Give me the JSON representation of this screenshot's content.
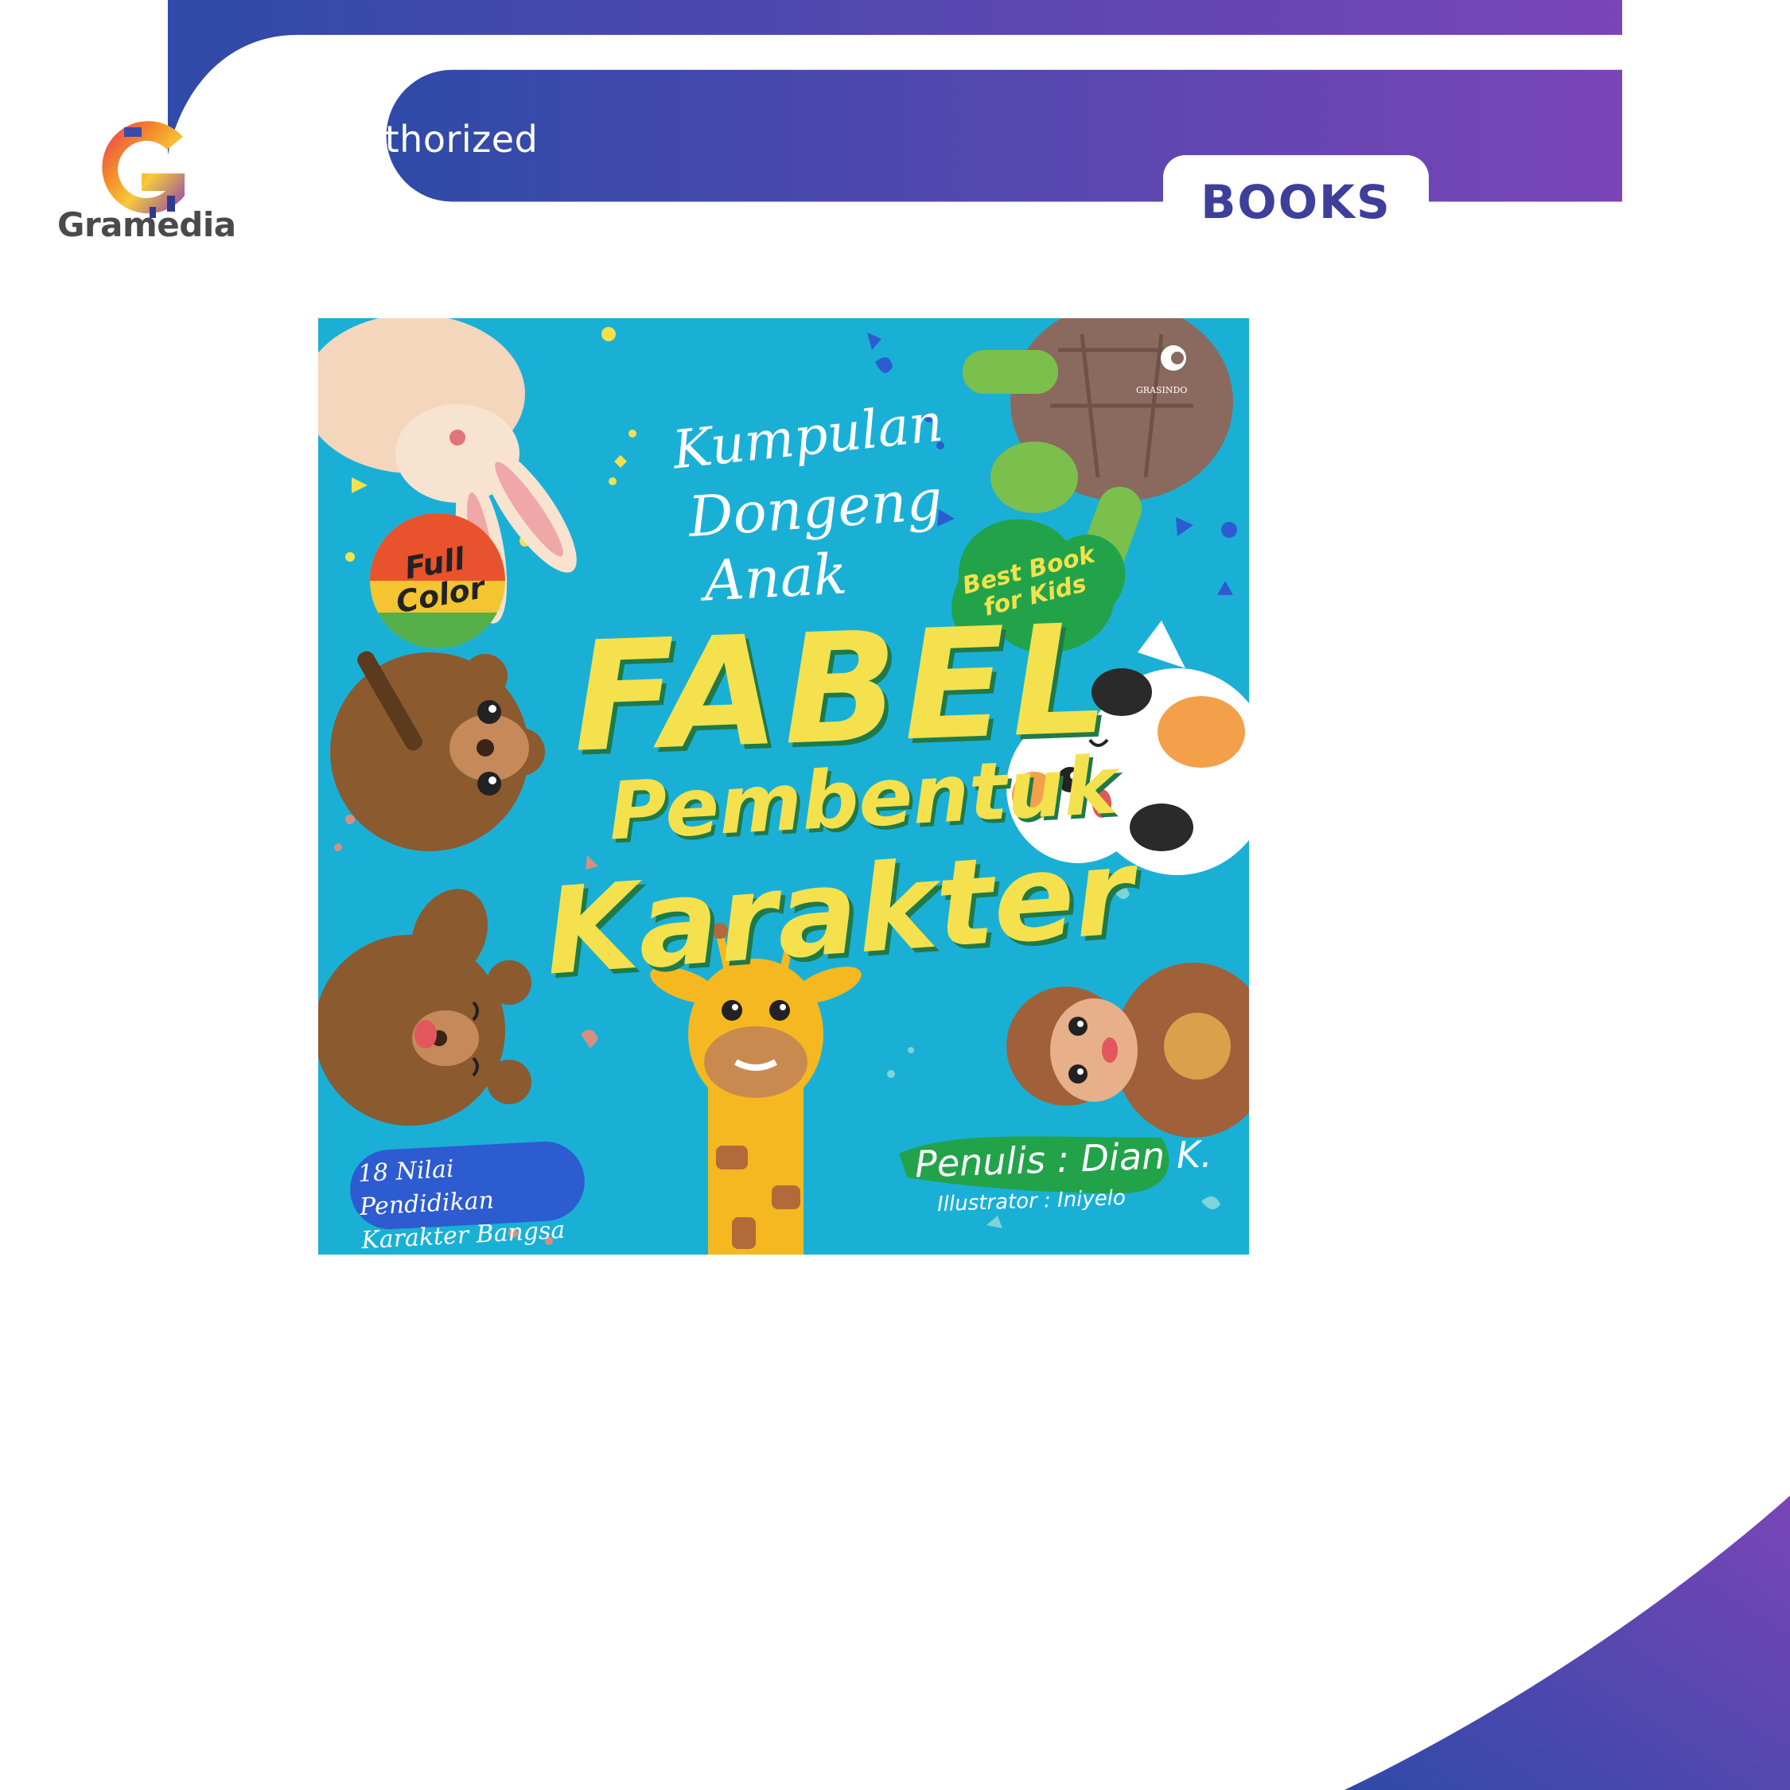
{
  "brand": {
    "name": "Gramedia",
    "colors": {
      "gradient_start": "#2f4aa8",
      "gradient_end": "#7a45b6",
      "tab_text": "#3d3f9a",
      "cover_bg": "#1ab0d6"
    }
  },
  "header": {
    "authorized_label": "Authorized",
    "category_tab": "BOOKS"
  },
  "book": {
    "publisher": "GRASINDO",
    "title_line1": "Kumpulan",
    "title_line2": "Dongeng",
    "title_line3": "Anak",
    "title_main1": "FABEL",
    "title_main2": "Pembentuk",
    "title_main3": "Karakter",
    "badge_full_color": "Full Color",
    "badge_best": "Best Book for Kids",
    "tagline": "18 Nilai Pendidikan Karakter Bangsa",
    "author_line": "Penulis : Dian K.",
    "illustrator_line": "Illustrator : Iniyelo"
  }
}
